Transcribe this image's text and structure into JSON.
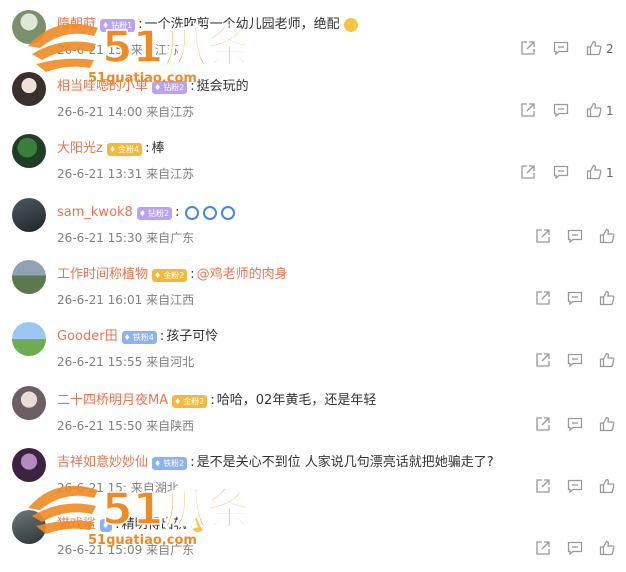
{
  "comments": [
    {
      "user": "隋朝莳",
      "badge": "钻粉1",
      "badge_color": "purple",
      "text": "一个洗吹剪一个幼儿园老师，绝配",
      "emoji": "yellow",
      "time": "26-6-21 15:",
      "source": "来自江苏",
      "likes": "2"
    },
    {
      "user": "相当哇嗯的小单",
      "badge": "钻粉2",
      "badge_color": "purple",
      "text": "挺会玩的",
      "time": "26-6-21 14:00",
      "source": "来自江苏",
      "likes": "1"
    },
    {
      "user": "大阳光z",
      "badge": "金粉4",
      "badge_color": "gold",
      "text": "棒",
      "time": "26-6-21 13:31",
      "source": "来自江苏",
      "likes": "1"
    },
    {
      "user": "sam_kwok8",
      "badge": "钻粉2",
      "badge_color": "purple",
      "text": "",
      "emoji_row": 3,
      "time": "26-6-21 15:30",
      "source": "来自广东",
      "likes": ""
    },
    {
      "user": "工作时间称植物",
      "badge": "金粉2",
      "badge_color": "gold",
      "text": "",
      "mention": "@鸡老师的肉身",
      "time": "26-6-21 16:01",
      "source": "来自江西",
      "likes": ""
    },
    {
      "user": "Gooder田",
      "badge": "铁粉4",
      "badge_color": "blue",
      "text": "孩子可怜",
      "time": "26-6-21 15:55",
      "source": "来自河北",
      "likes": ""
    },
    {
      "user": "二十四桥明月夜MA",
      "badge": "金粉2",
      "badge_color": "gold",
      "text": "哈哈，02年黄毛，还是年轻",
      "time": "26-6-21 15:50",
      "source": "来自陕西",
      "likes": ""
    },
    {
      "user": "吉祥如意妙妙仙",
      "badge": "铁粉2",
      "badge_color": "blue",
      "text": "是不是关心不到位 人家说几句漂亮话就把她骗走了?",
      "time": "26-6-21 15:",
      "source": "来自湖北",
      "likes": ""
    },
    {
      "user": "猫戏鲨",
      "badge": "",
      "badge_color": "blue",
      "text": "精明得出轨",
      "emoji": "yellow",
      "time": "26-6-21 15:09",
      "source": "来自广东",
      "likes": ""
    }
  ],
  "watermark": {
    "brand": "51瓜条",
    "url": "51guatiao.com"
  }
}
